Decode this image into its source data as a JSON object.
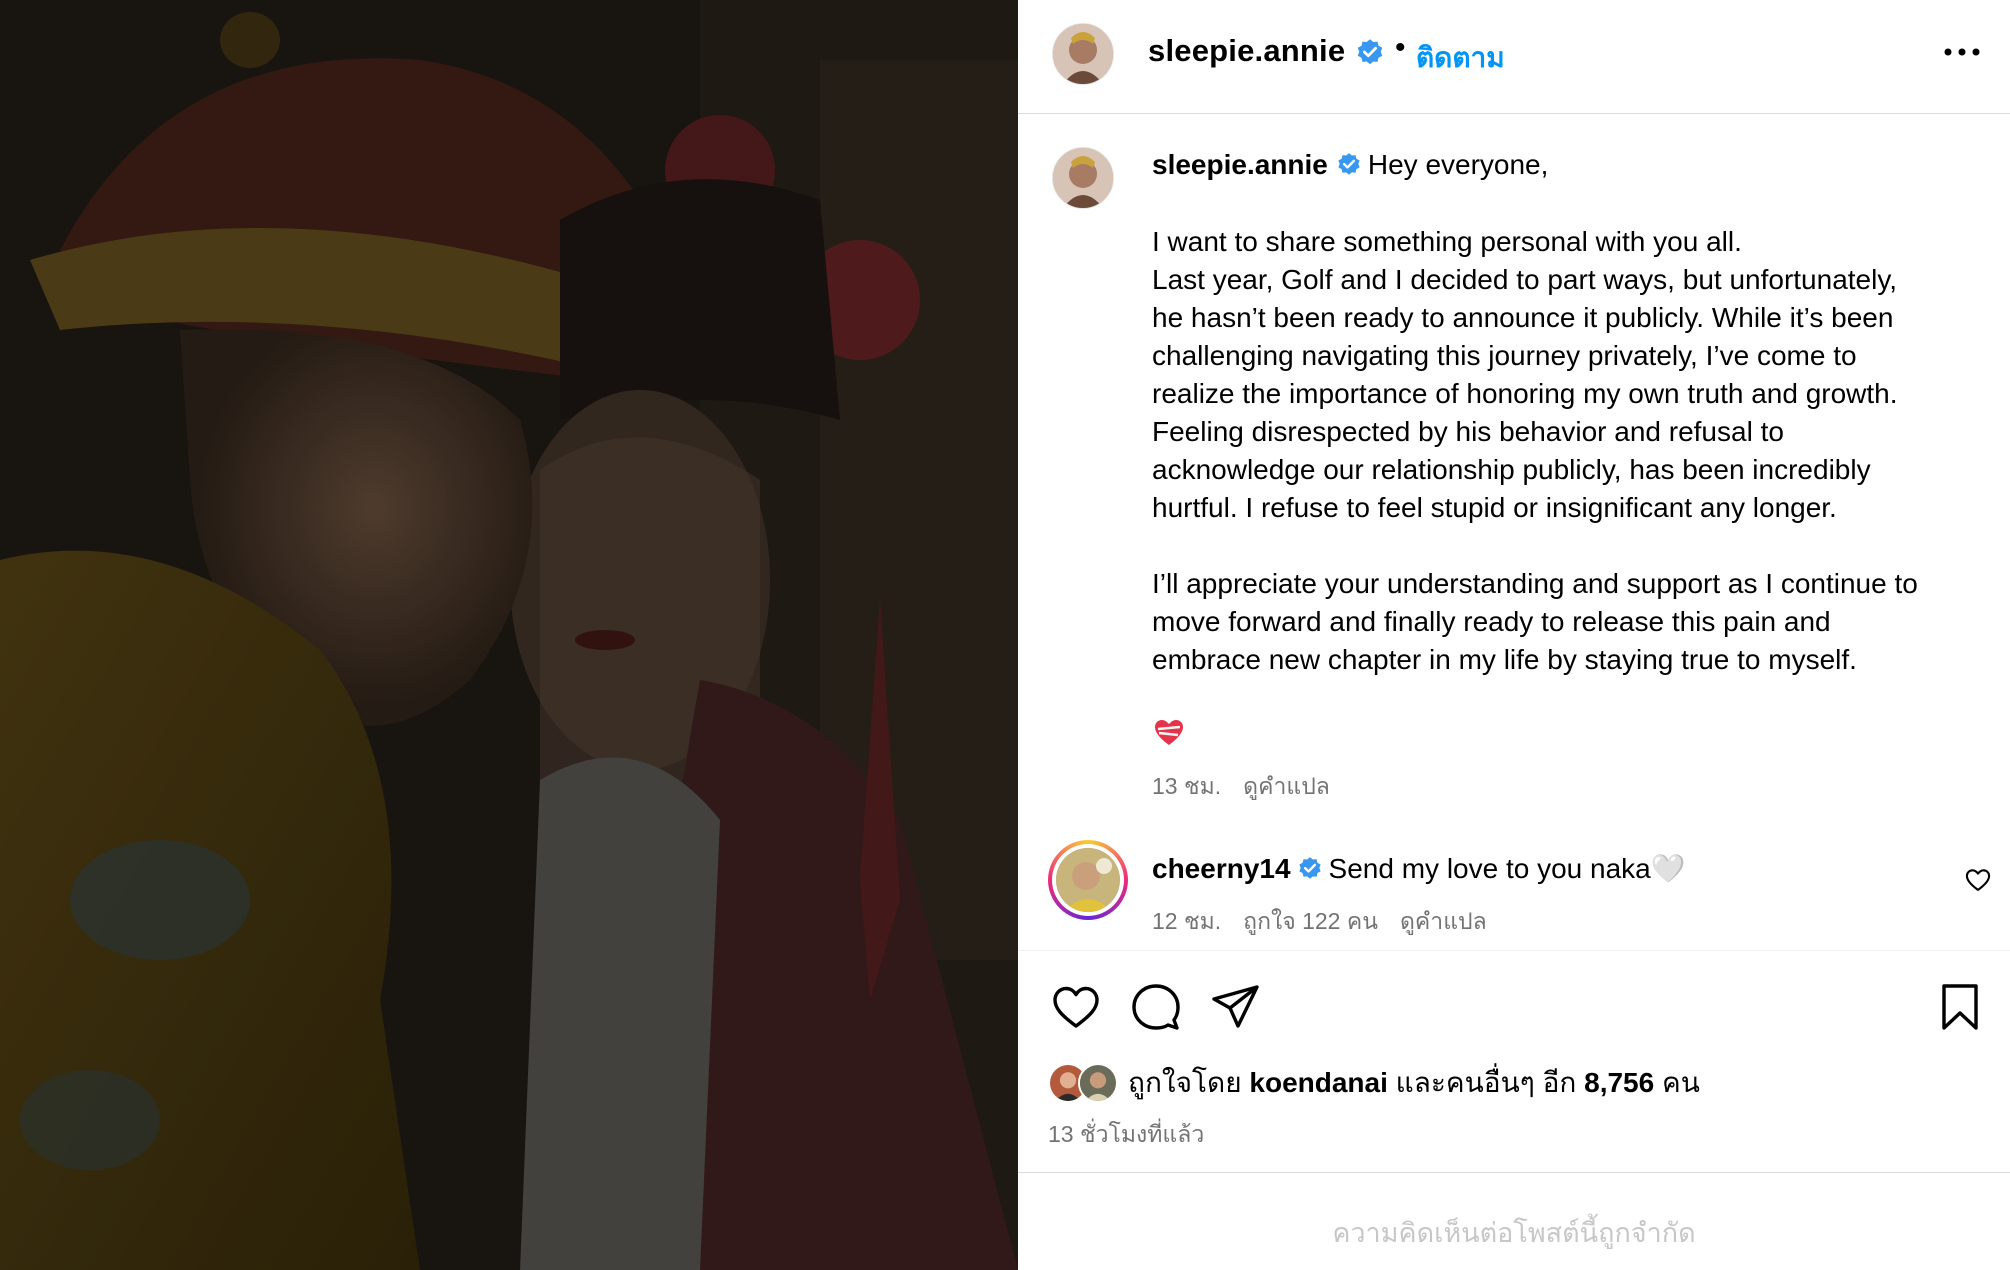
{
  "post": {
    "username": "sleepie.annie",
    "separator": "•",
    "follow_label": "ติดตาม",
    "more_icon": "more-horizontal-icon",
    "verified_icon": "verified-badge-icon"
  },
  "caption": {
    "username": "sleepie.annie",
    "greeting": "Hey everyone,",
    "paragraph1": [
      "I want to share something personal with you all.",
      "Last year, Golf and I decided to part ways, but unfortunately,",
      "he hasn’t been ready to announce it publicly. While it’s been",
      "challenging navigating this journey privately, I’ve come to",
      "realize the importance of honoring my own truth and growth.",
      "Feeling disrespected by his behavior and refusal to",
      "acknowledge our relationship publicly, has been incredibly",
      "hurtful. I refuse to feel stupid or insignificant any longer."
    ],
    "paragraph2": [
      "I’ll appreciate your understanding and support as I continue to",
      "move forward and finally ready to release this pain and",
      "embrace new chapter in my life by staying true to myself."
    ],
    "emoji": "❤️‍🩹",
    "time": "13 ชม.",
    "see_translation": "ดูคำแปล"
  },
  "comment": {
    "username": "cheerny14",
    "text": "Send my love to you naka🤍",
    "time": "12 ชม.",
    "likes": "ถูกใจ 122 คน",
    "see_translation": "ดูคำแปล"
  },
  "actions": {
    "icons": [
      "heart-icon",
      "comment-icon",
      "share-icon",
      "bookmark-icon"
    ]
  },
  "likes": {
    "prefix": "ถูกใจโดย",
    "user": "koendanai",
    "middle": "และคนอื่นๆ อีก",
    "count": "8,756",
    "suffix": "คน"
  },
  "time_ago": "13 ชั่วโมงที่แล้ว",
  "comments_limited": "ความคิดเห็นต่อโพสต์นี้ถูกจำกัด",
  "colors": {
    "accent_blue": "#0095f6",
    "secondary_text": "#737373",
    "divider": "#dbdbdb",
    "verified": "#3897f0"
  }
}
